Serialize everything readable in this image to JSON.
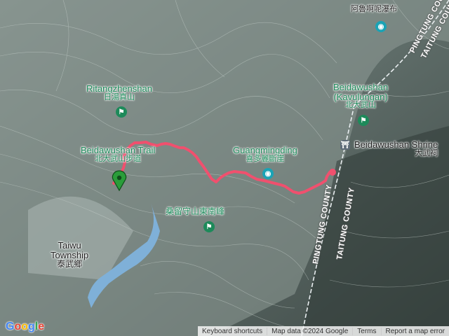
{
  "labels": {
    "aluna": {
      "zh": "阿魯啊呢瀑布"
    },
    "ritang": {
      "en": "Ritangzhenshan",
      "zh": "日湯真山"
    },
    "beidawu": {
      "en1": "Beidawushan",
      "en2": "(Kavulungan)",
      "zh": "北大武山"
    },
    "shrine": {
      "en": "Beidawushan Shrine",
      "zh": "大武祠"
    },
    "guangming": {
      "en": "Guangmingding",
      "zh": "喜多麗斷崖"
    },
    "trail": {
      "en": "Beidawushan Trail",
      "zh": "北大武山步道"
    },
    "sangliu": {
      "zh": "桑留守山東南峰"
    },
    "taiwu": {
      "en1": "Taiwu",
      "en2": "Township",
      "zh": "泰武鄉"
    }
  },
  "county_lines": [
    "PINGTUNG COUNTY",
    "TAITUNG COUNTY",
    "PINGTUNG COUNTY",
    "TAITUNG COUNTY"
  ],
  "footer": {
    "shortcuts": "Keyboard shortcuts",
    "mapdata": "Map data ©2024 Google",
    "terms": "Terms",
    "report": "Report a map error"
  },
  "logo": "Google",
  "colors": {
    "route": "#f0506e",
    "label_green": "#1d8a5a",
    "camera_poi": "#1aa3b5",
    "water": "#7fb0d8"
  }
}
